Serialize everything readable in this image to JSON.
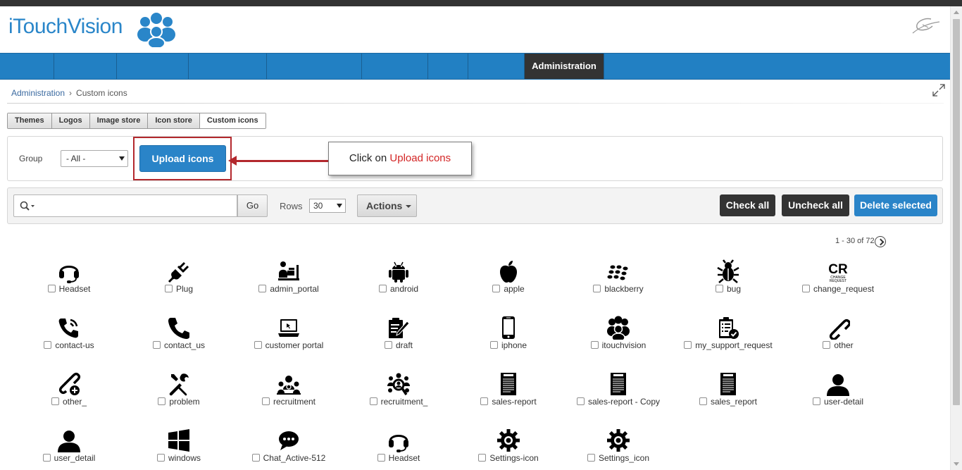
{
  "brand": {
    "name": "iTouchVision"
  },
  "nav": {
    "items": [
      {
        "label": ""
      },
      {
        "label": ""
      },
      {
        "label": ""
      },
      {
        "label": ""
      },
      {
        "label": ""
      },
      {
        "label": ""
      },
      {
        "label": ""
      },
      {
        "label": ""
      },
      {
        "label": "Administration"
      }
    ],
    "active_index": 8
  },
  "breadcrumb": {
    "parent": "Administration",
    "current": "Custom icons"
  },
  "tabs": [
    {
      "label": "Themes"
    },
    {
      "label": "Logos"
    },
    {
      "label": "Image store"
    },
    {
      "label": "Icon store"
    },
    {
      "label": "Custom icons"
    }
  ],
  "group": {
    "label": "Group",
    "selected": "- All -"
  },
  "upload": {
    "label": "Upload icons"
  },
  "callout": {
    "prefix": "Click on ",
    "highlight": "Upload icons"
  },
  "toolbar": {
    "go": "Go",
    "rows_label": "Rows",
    "rows_value": "30",
    "actions": "Actions",
    "check_all": "Check all",
    "uncheck_all": "Uncheck all",
    "delete_selected": "Delete selected"
  },
  "pager": {
    "text": "1 - 30 of 72"
  },
  "colors": {
    "nav_blue": "#2280c3",
    "accent_blue": "#2a84c8",
    "dark": "#333333",
    "highlight_red": "#b3282d"
  },
  "icons": [
    {
      "label": "Headset",
      "glyph": "headset-icon"
    },
    {
      "label": "Plug",
      "glyph": "plug-icon"
    },
    {
      "label": "admin_portal",
      "glyph": "admin-portal-icon"
    },
    {
      "label": "android",
      "glyph": "android-icon"
    },
    {
      "label": "apple",
      "glyph": "apple-icon"
    },
    {
      "label": "blackberry",
      "glyph": "blackberry-icon"
    },
    {
      "label": "bug",
      "glyph": "bug-icon"
    },
    {
      "label": "change_request",
      "glyph": "change-request-icon"
    },
    {
      "label": "contact-us",
      "glyph": "phone-ring-icon"
    },
    {
      "label": "contact_us",
      "glyph": "phone-icon"
    },
    {
      "label": "customer portal",
      "glyph": "laptop-icon"
    },
    {
      "label": "draft",
      "glyph": "draft-icon"
    },
    {
      "label": "iphone",
      "glyph": "iphone-icon"
    },
    {
      "label": "itouchvision",
      "glyph": "people-group-icon"
    },
    {
      "label": "my_support_request",
      "glyph": "clipboard-check-icon"
    },
    {
      "label": "other",
      "glyph": "link-icon"
    },
    {
      "label": "other_",
      "glyph": "link-plus-icon"
    },
    {
      "label": "problem",
      "glyph": "tools-icon"
    },
    {
      "label": "recruitment",
      "glyph": "recruitment-icon"
    },
    {
      "label": "recruitment_",
      "glyph": "recruitment-search-icon"
    },
    {
      "label": "sales-report",
      "glyph": "report-icon"
    },
    {
      "label": "sales-report - Copy",
      "glyph": "report-icon"
    },
    {
      "label": "sales_report",
      "glyph": "report-icon"
    },
    {
      "label": "user-detail",
      "glyph": "user-icon"
    },
    {
      "label": "user_detail",
      "glyph": "user-icon"
    },
    {
      "label": "windows",
      "glyph": "windows-icon"
    },
    {
      "label": "Chat_Active-512",
      "glyph": "chat-icon"
    },
    {
      "label": "Headset",
      "glyph": "headset-icon"
    },
    {
      "label": "Settings-icon",
      "glyph": "gear-icon"
    },
    {
      "label": "Settings_icon",
      "glyph": "gear-icon"
    }
  ]
}
